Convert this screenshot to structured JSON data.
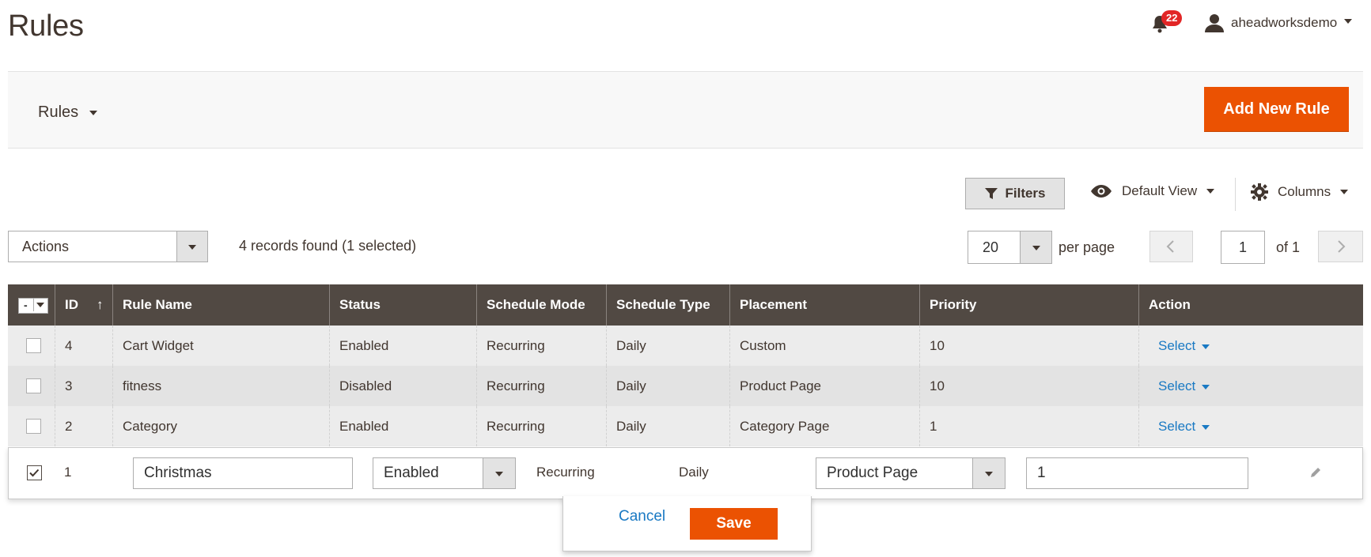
{
  "header": {
    "title": "Rules",
    "notifications_count": "22",
    "username": "aheadworksdemo"
  },
  "toolbar": {
    "switcher_label": "Rules",
    "add_button": "Add New Rule"
  },
  "controls": {
    "filters_label": "Filters",
    "view_label": "Default View",
    "columns_label": "Columns",
    "actions_label": "Actions",
    "records_text": "4 records found (1 selected)",
    "per_page_value": "20",
    "per_page_label": "per page",
    "page_value": "1",
    "of_label": "of 1"
  },
  "grid": {
    "mass_select_label": "-",
    "columns": [
      "ID",
      "Rule Name",
      "Status",
      "Schedule Mode",
      "Schedule Type",
      "Placement",
      "Priority",
      "Action"
    ],
    "rows": [
      {
        "id": "4",
        "name": "Cart Widget",
        "status": "Enabled",
        "mode": "Recurring",
        "type": "Daily",
        "placement": "Custom",
        "priority": "10",
        "action": "Select"
      },
      {
        "id": "3",
        "name": "fitness",
        "status": "Disabled",
        "mode": "Recurring",
        "type": "Daily",
        "placement": "Product Page",
        "priority": "10",
        "action": "Select"
      },
      {
        "id": "2",
        "name": "Category",
        "status": "Enabled",
        "mode": "Recurring",
        "type": "Daily",
        "placement": "Category Page",
        "priority": "1",
        "action": "Select"
      }
    ],
    "editing_row": {
      "id": "1",
      "name": "Christmas",
      "status": "Enabled",
      "mode": "Recurring",
      "type": "Daily",
      "placement": "Product Page",
      "priority": "1"
    }
  },
  "edit_actions": {
    "cancel": "Cancel",
    "save": "Save"
  },
  "colors": {
    "accent": "#eb5202",
    "header_bg": "#514943",
    "link": "#1979c3",
    "badge": "#e22626"
  }
}
